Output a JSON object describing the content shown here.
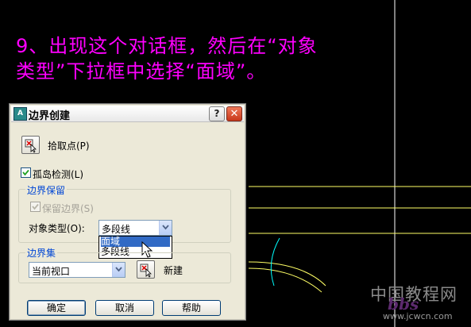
{
  "instruction": {
    "line1": "9、出现这个对话框，然后在“对象",
    "line2": "类型”下拉框中选择“面域”。"
  },
  "dialog": {
    "title": "边界创建",
    "help_label": "?",
    "close_label": "✕",
    "pick_points_label": "拾取点(P)",
    "island_detection_label": "孤岛检测(L)",
    "island_detection_checked": true,
    "boundary_retention": {
      "group_title": "边界保留",
      "retain_label": "保留边界(S)",
      "retain_checked": true,
      "object_type_label": "对象类型(O):",
      "object_type_value": "多段线",
      "options": [
        "面域",
        "多段线"
      ],
      "highlighted_option": "面域"
    },
    "boundary_set": {
      "group_title": "边界集",
      "value": "当前视口",
      "new_label": "新建"
    },
    "buttons": {
      "ok": "确定",
      "cancel": "取消",
      "help": "帮助"
    }
  },
  "watermark": {
    "line1": "中国教程网",
    "line2": "www.jcwcn.com",
    "overlay": "bbs"
  },
  "colors": {
    "background": "#000000",
    "instruction_text": "#ff00ff",
    "cad_lines": "#ffff66",
    "dialog_face": "#ece9d8",
    "group_title": "#0046d5"
  }
}
